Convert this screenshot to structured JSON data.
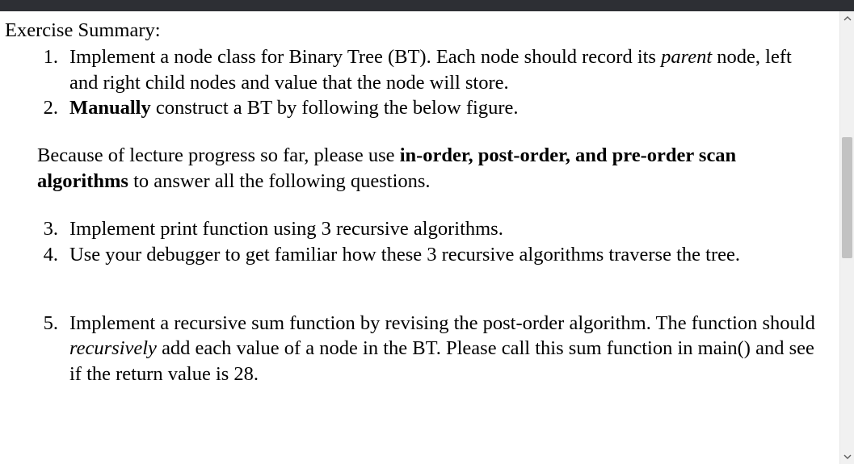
{
  "heading": "Exercise Summary:",
  "items": {
    "n1": "1.",
    "t1a": "Implement a node class for Binary Tree (BT). Each node should record its ",
    "t1_parent": "parent",
    "t1b": " node, left and right child nodes and value that the node will store.",
    "n2": "2.",
    "t2_manually": "Manually",
    "t2b": " construct a BT by following the below figure.",
    "inter_a": "Because of lecture progress so far, please use ",
    "inter_bold": "in-order, post-order, and pre-order scan algorithms",
    "inter_b": " to answer all the following questions.",
    "n3": "3.",
    "t3": "Implement print function using 3 recursive algorithms.",
    "n4": "4.",
    "t4": "Use your debugger to get familiar how these 3 recursive algorithms traverse the tree.",
    "n5": "5.",
    "t5a": "Implement a recursive sum function by revising the post-order algorithm. The function should ",
    "t5_rec": "recursively",
    "t5b": " add each value of a node in the BT. Please call this sum function in main() and see if the return value is  28."
  }
}
